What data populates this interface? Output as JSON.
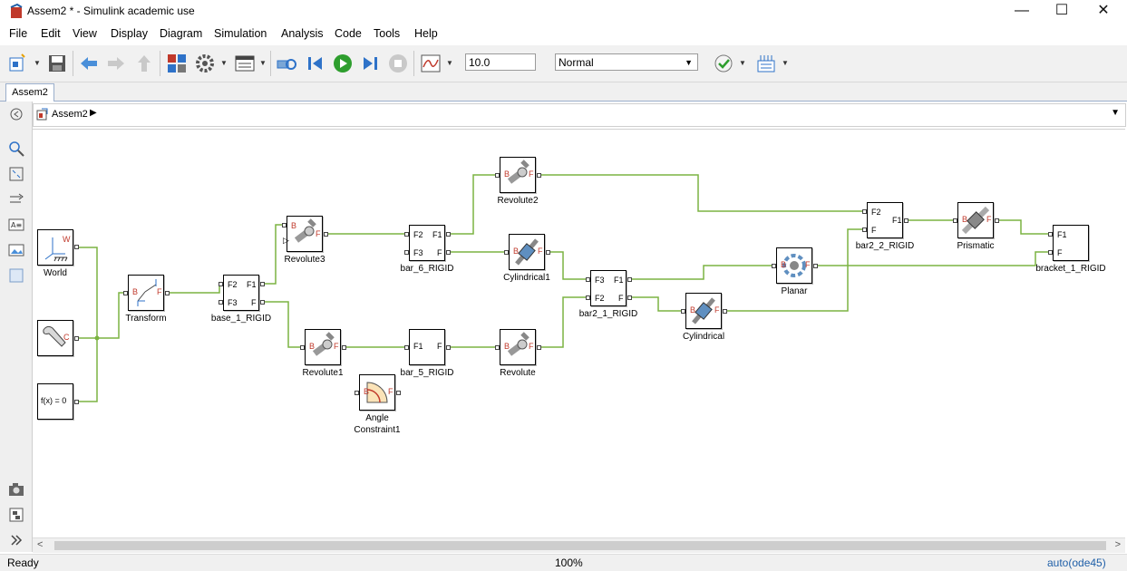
{
  "window": {
    "title": "Assem2 * - Simulink academic use",
    "minimize": "—",
    "maximize": "☐",
    "close": "✕"
  },
  "menu": [
    "File",
    "Edit",
    "View",
    "Display",
    "Diagram",
    "Simulation",
    "Analysis",
    "Code",
    "Tools",
    "Help"
  ],
  "toolbar": {
    "stop_time": "10.0",
    "sim_mode": "Normal"
  },
  "tabs": [
    "Assem2"
  ],
  "breadcrumb": {
    "model": "Assem2"
  },
  "blocks": {
    "world": "World",
    "mechconfig": "",
    "solverconfig": "f(x) = 0",
    "transform": "Transform",
    "base": "base_1_RIGID",
    "revolute3": "Revolute3",
    "revolute1": "Revolute1",
    "bar6": "bar_6_RIGID",
    "bar5": "bar_5_RIGID",
    "angle_line1": "Angle",
    "angle_line2": "Constraint1",
    "revolute2": "Revolute2",
    "cylindrical1": "Cylindrical1",
    "revolute": "Revolute",
    "bar21": "bar2_1_RIGID",
    "cylindrical": "Cylindrical",
    "planar": "Planar",
    "bar22": "bar2_2_RIGID",
    "prismatic": "Prismatic",
    "bracket": "bracket_1_RIGID"
  },
  "ports": {
    "W": "W",
    "C": "C",
    "B": "B",
    "F": "F",
    "F1": "F1",
    "F2": "F2",
    "F3": "F3"
  },
  "status": {
    "left": "Ready",
    "zoom": "100%",
    "solver": "auto(ode45)"
  },
  "colors": {
    "connection": "#7cb342",
    "accent_blue": "#2e72c8",
    "run_green": "#2e9e2e"
  }
}
